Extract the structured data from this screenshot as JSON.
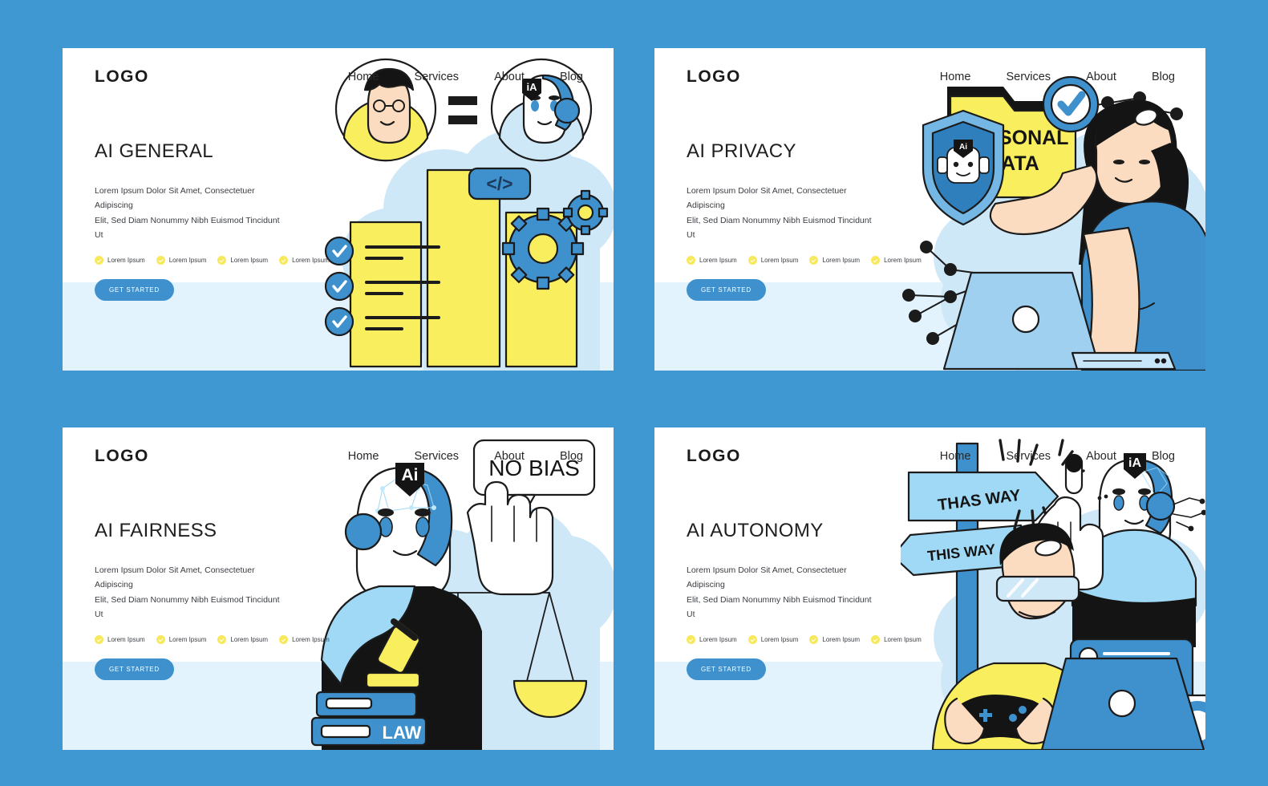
{
  "theme": {
    "page_background": "#3f98d1",
    "card_background": "#ffffff",
    "band_background": "#e2f3fd",
    "cloud_color": "#cfe8f8",
    "accent_blue": "#3f91cd",
    "accent_yellow": "#f9ef5e",
    "text_dark": "#1f1f1f"
  },
  "common": {
    "logo": "LOGO",
    "nav": [
      {
        "label": "Home"
      },
      {
        "label": "Services"
      },
      {
        "label": "About"
      },
      {
        "label": "Blog"
      }
    ],
    "subtitle_line1": "Lorem Ipsum Dolor Sit Amet, Consectetuer Adipiscing",
    "subtitle_line2": "Elit, Sed Diam Nonummy Nibh Euismod Tincidunt Ut",
    "bullets": [
      {
        "label": "Lorem Ipsum"
      },
      {
        "label": "Lorem Ipsum"
      },
      {
        "label": "Lorem Ipsum"
      },
      {
        "label": "Lorem Ipsum"
      }
    ],
    "cta_label": "GET STARTED"
  },
  "panels": [
    {
      "id": "ai-general",
      "title": "AI GENERAL",
      "illustration": {
        "name": "human-equals-robot-with-checklist-gears",
        "labels": [
          {
            "name": "ai-badge",
            "text": "iA"
          },
          {
            "name": "code-badge",
            "text": "</>"
          },
          {
            "name": "equals-sign",
            "text": "="
          }
        ]
      }
    },
    {
      "id": "ai-privacy",
      "title": "AI PRIVACY",
      "illustration": {
        "name": "woman-with-personal-data-folder-and-shield",
        "labels": [
          {
            "name": "folder-label-line1",
            "text": "PERSONAL"
          },
          {
            "name": "folder-label-line2",
            "text": "DATA"
          },
          {
            "name": "shield-ai-badge",
            "text": "Ai"
          }
        ]
      }
    },
    {
      "id": "ai-fairness",
      "title": "AI FAIRNESS",
      "illustration": {
        "name": "robot-judge-with-scales-gavel-and-law-book",
        "labels": [
          {
            "name": "speech-bubble",
            "text": "NO BIAS"
          },
          {
            "name": "ai-badge",
            "text": "Ai"
          },
          {
            "name": "law-book-label",
            "text": "LAW"
          }
        ]
      }
    },
    {
      "id": "ai-autonomy",
      "title": "AI AUTONOMY",
      "illustration": {
        "name": "gamer-and-robot-with-direction-signposts",
        "labels": [
          {
            "name": "signpost-upper",
            "text": "THAS WAY"
          },
          {
            "name": "signpost-lower",
            "text": "THIS WAY"
          },
          {
            "name": "ai-badge",
            "text": "iA"
          }
        ]
      }
    }
  ]
}
